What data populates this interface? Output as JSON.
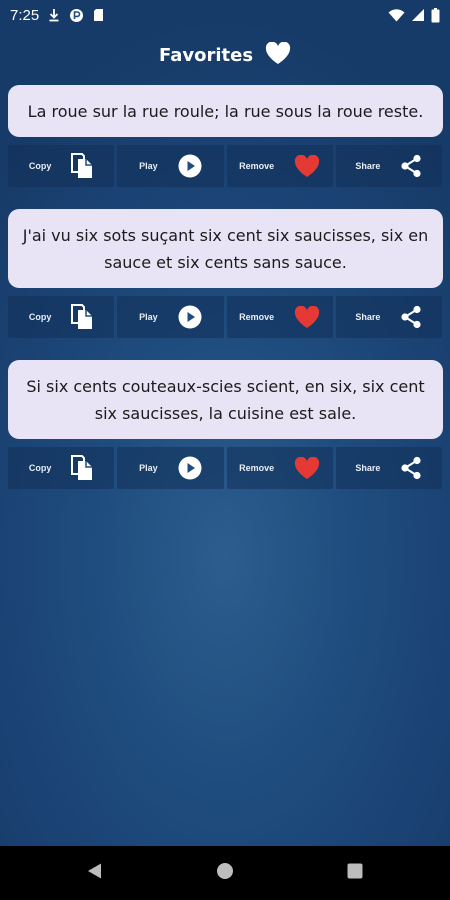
{
  "status_bar": {
    "time": "7:25",
    "icons": [
      "download-icon",
      "p-badge-icon",
      "sd-card-icon",
      "wifi-icon",
      "signal-icon",
      "battery-icon"
    ]
  },
  "app_bar": {
    "title": "Favorites",
    "icon": "heart-icon"
  },
  "favorites": [
    {
      "text": "La roue sur la rue roule; la rue sous la roue reste.",
      "actions": {
        "copy": "Copy",
        "play": "Play",
        "remove": "Remove",
        "share": "Share"
      }
    },
    {
      "text": "J'ai vu six sots suçant six cent six saucisses, six en sauce et six cents sans sauce.",
      "actions": {
        "copy": "Copy",
        "play": "Play",
        "remove": "Remove",
        "share": "Share"
      }
    },
    {
      "text": "Si six cents couteaux-scies scient, en six, six cent six saucisses, la cuisine est sale.",
      "actions": {
        "copy": "Copy",
        "play": "Play",
        "remove": "Remove",
        "share": "Share"
      }
    }
  ],
  "colors": {
    "card_background": "#e9e4f5",
    "remove_heart": "#e53935",
    "background": "#1f4d7f"
  },
  "nav_bar": {
    "buttons": [
      "back-icon",
      "home-icon",
      "recents-icon"
    ]
  }
}
